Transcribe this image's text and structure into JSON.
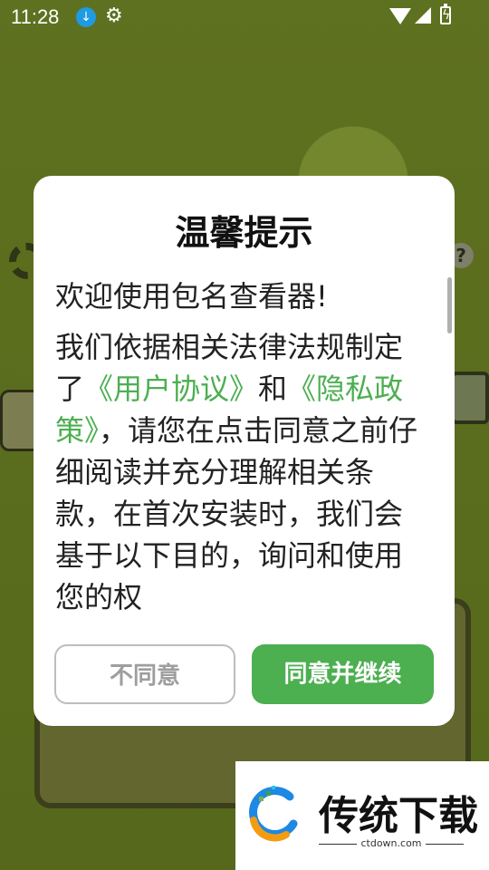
{
  "status_bar": {
    "time": "11:28",
    "icons": [
      "download-icon",
      "gear-icon",
      "wifi-icon",
      "signal-icon",
      "battery-charging-icon"
    ],
    "download_glyph": "↓",
    "gear_glyph": "⚙"
  },
  "dialog": {
    "title": "温馨提示",
    "welcome": "欢迎使用包名查看器!",
    "body_part1": "我们依据相关法律法规制定了",
    "user_agreement_link": "《用户协议》",
    "and": "和",
    "privacy_policy_link": "《隐私政策》",
    "body_part2": "，请您在点击同意之前仔细阅读并充分理解相关条款，在首次安装时，我们会基于以下目的，询问和使用您的权",
    "disagree_label": "不同意",
    "agree_label": "同意并继续",
    "colors": {
      "accent": "#4caf50",
      "disagree_text": "#9e9e9e"
    }
  },
  "watermark": {
    "brand": "传统下载",
    "url": "ctdown.com"
  }
}
